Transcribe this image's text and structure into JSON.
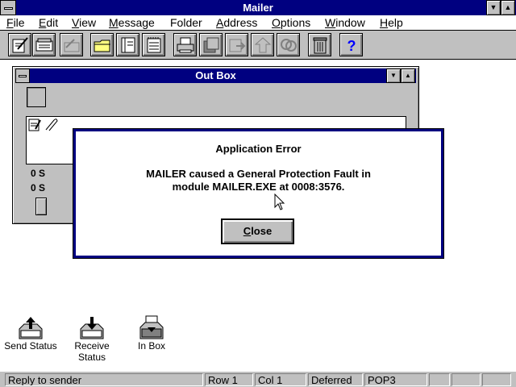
{
  "app": {
    "title": "Mailer"
  },
  "menu": {
    "items": [
      {
        "key": "F",
        "rest": "ile"
      },
      {
        "key": "E",
        "rest": "dit"
      },
      {
        "key": "V",
        "rest": "iew"
      },
      {
        "key": "M",
        "rest": "essage"
      },
      {
        "key": "",
        "rest": "Folder"
      },
      {
        "key": "A",
        "rest": "ddress"
      },
      {
        "key": "O",
        "rest": "ptions"
      },
      {
        "key": "W",
        "rest": "indow"
      },
      {
        "key": "H",
        "rest": "elp"
      }
    ]
  },
  "toolbar": {
    "icons": [
      "compose-icon",
      "read-icon",
      "reply-icon",
      "folder-icon",
      "notebook-icon",
      "notepad-icon",
      "print-icon",
      "save-icon",
      "forward-icon",
      "move-icon",
      "copy-icon",
      "trash-icon",
      "help-icon"
    ]
  },
  "outbox": {
    "title": "Out Box",
    "status1": "0 S",
    "status2": "0 S"
  },
  "dialog": {
    "title": "Application Error",
    "line1": "MAILER caused a General Protection Fault in",
    "line2": "module MAILER.EXE at 0008:3576.",
    "close_key": "C",
    "close_rest": "lose"
  },
  "desktop": {
    "icons": [
      {
        "label": "Send Status",
        "icon": "send-status-icon"
      },
      {
        "label": "Receive Status",
        "icon": "receive-status-icon"
      },
      {
        "label": "In Box",
        "icon": "inbox-icon"
      }
    ]
  },
  "statusbar": {
    "message": "Reply to sender",
    "row": "Row 1",
    "col": "Col  1",
    "mode": "Deferred",
    "protocol": "POP3"
  },
  "colors": {
    "title_bar": "#000080",
    "face": "#c0c0c0",
    "desktop": "#ffffff",
    "help_blue": "#0000ff"
  }
}
